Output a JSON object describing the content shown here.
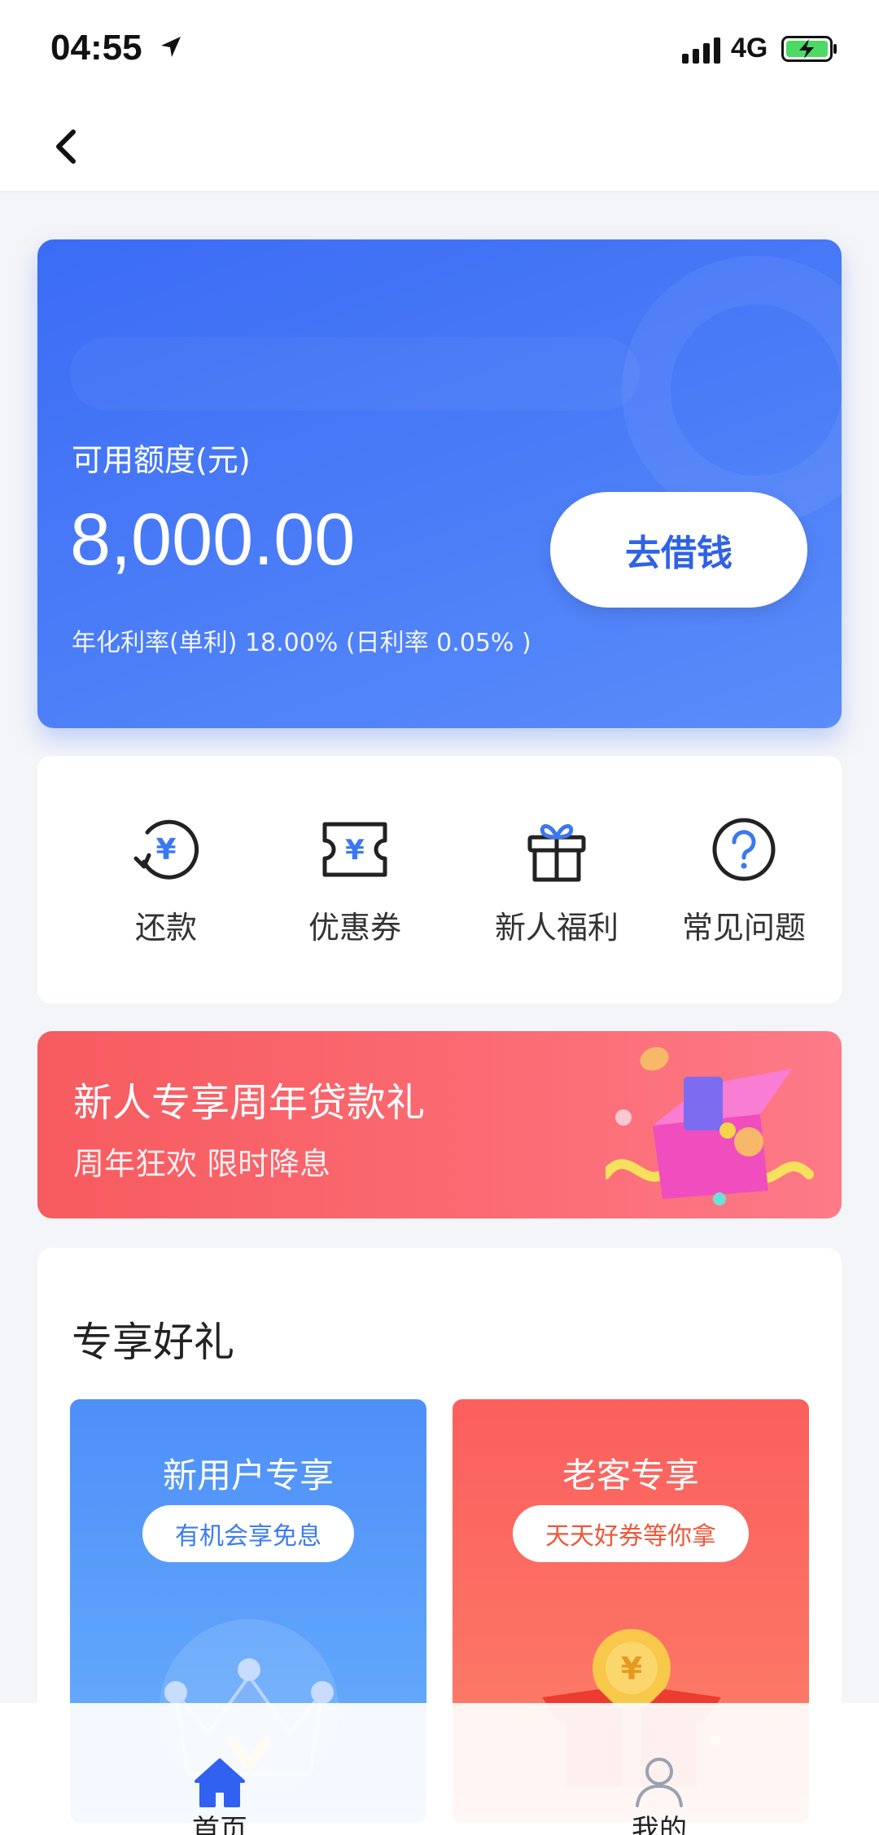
{
  "status_bar": {
    "time": "04:55",
    "network": "4G"
  },
  "credit": {
    "label": "可用额度(元)",
    "amount": "8,000.00",
    "borrow_button": "去借钱",
    "rate": "年化利率(单利) 18.00% (日利率 0.05% )"
  },
  "quick_menu": {
    "items": [
      {
        "label": "还款",
        "icon": "repay-yuan-icon"
      },
      {
        "label": "优惠券",
        "icon": "coupon-icon"
      },
      {
        "label": "新人福利",
        "icon": "gift-icon"
      },
      {
        "label": "常见问题",
        "icon": "question-icon"
      }
    ]
  },
  "promo": {
    "title": "新人专享周年贷款礼",
    "subtitle": "周年狂欢 限时降息"
  },
  "gifts": {
    "title": "专享好礼",
    "cards": [
      {
        "title": "新用户专享",
        "pill": "有机会享免息"
      },
      {
        "title": "老客专享",
        "pill": "天天好券等你拿"
      }
    ]
  },
  "tab_bar": {
    "items": [
      {
        "label": "首页",
        "active": true
      },
      {
        "label": "我的",
        "active": false
      }
    ]
  },
  "colors": {
    "primary": "#3b6cf5",
    "promo": "#f65b5f",
    "accent_text": "#2f62e6"
  }
}
